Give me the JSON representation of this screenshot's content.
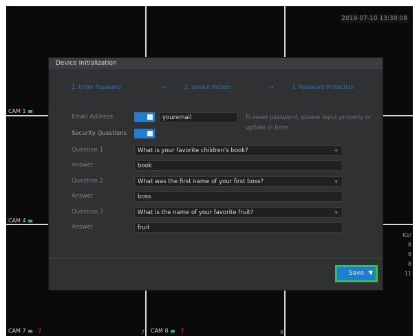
{
  "screen": {
    "datetime": "2019-07-10 13:39:08",
    "cameras": [
      {
        "label": "CAM 1"
      },
      {
        "label": "CAM 4"
      },
      {
        "label": "CAM 7",
        "alert": "?"
      },
      {
        "label": "CAM 8",
        "alert": "?"
      }
    ],
    "channel_numbers": [
      "7",
      "8"
    ],
    "bitrate": {
      "unit": "Kb/",
      "values": [
        "8",
        "8",
        "8",
        "11"
      ]
    }
  },
  "dialog": {
    "title": "Device Initialization",
    "steps": [
      "1.  Enter Password",
      "→",
      "2.  Unlock Pattern",
      "→",
      "3.  Password Protection"
    ],
    "email": {
      "label": "Email Address",
      "value": "youremail",
      "hint": "To reset password, please input properly or update in time"
    },
    "security_questions_label": "Security Questions",
    "questions": [
      {
        "label": "Question 1",
        "value": "What is your favorite children's book?",
        "answer_label": "Answer",
        "answer": "book"
      },
      {
        "label": "Question 2",
        "value": "What was the first name of your first boss?",
        "answer_label": "Answer",
        "answer": "boss"
      },
      {
        "label": "Question 3",
        "value": "What is the name of your favorite fruit?",
        "answer_label": "Answer",
        "answer": "fruit"
      }
    ],
    "save_label": "Save"
  },
  "colors": {
    "accent": "#1e7fce",
    "highlight": "#35c536",
    "record": "#35b34a",
    "alert": "#d02020"
  }
}
